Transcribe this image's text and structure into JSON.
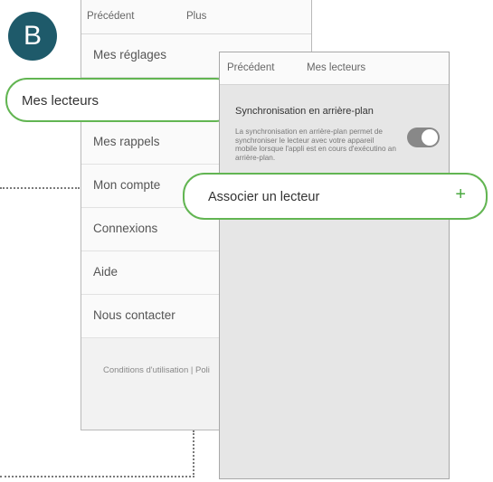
{
  "badge": "B",
  "screen_plus": {
    "back_label": "Précédent",
    "title": "Plus",
    "items": [
      {
        "label": "Mes réglages"
      },
      {
        "label": "Mes lecteurs"
      },
      {
        "label": "Mes rappels"
      },
      {
        "label": "Mon compte"
      },
      {
        "label": "Connexions"
      },
      {
        "label": "Aide"
      },
      {
        "label": "Nous contacter"
      }
    ],
    "footer": "Conditions d'utilisation   |   Poli"
  },
  "screen_lecteurs": {
    "back_label": "Précédent",
    "title": "Mes lecteurs",
    "sync_title": "Synchronisation en arrière-plan",
    "sync_description": "La synchronisation en arrière-plan permet de synchroniser le lecteur avec votre appareil mobile lorsque l'appli est en cours d'exécutino an arrière-plan.",
    "sync_enabled": true,
    "add_reader_label": "Associer un lecteur",
    "add_icon": "+"
  },
  "colors": {
    "highlight": "#62b552",
    "badge": "#1e5a6a"
  }
}
